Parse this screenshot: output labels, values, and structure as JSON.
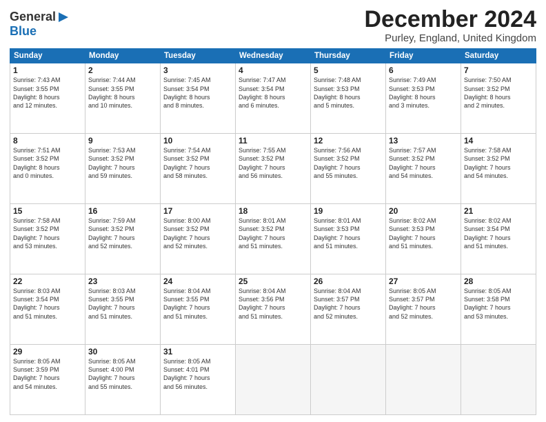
{
  "header": {
    "logo_line1": "General",
    "logo_line2": "Blue",
    "month": "December 2024",
    "location": "Purley, England, United Kingdom"
  },
  "weekdays": [
    "Sunday",
    "Monday",
    "Tuesday",
    "Wednesday",
    "Thursday",
    "Friday",
    "Saturday"
  ],
  "weeks": [
    [
      {
        "day": "1",
        "lines": [
          "Sunrise: 7:43 AM",
          "Sunset: 3:55 PM",
          "Daylight: 8 hours",
          "and 12 minutes."
        ]
      },
      {
        "day": "2",
        "lines": [
          "Sunrise: 7:44 AM",
          "Sunset: 3:55 PM",
          "Daylight: 8 hours",
          "and 10 minutes."
        ]
      },
      {
        "day": "3",
        "lines": [
          "Sunrise: 7:45 AM",
          "Sunset: 3:54 PM",
          "Daylight: 8 hours",
          "and 8 minutes."
        ]
      },
      {
        "day": "4",
        "lines": [
          "Sunrise: 7:47 AM",
          "Sunset: 3:54 PM",
          "Daylight: 8 hours",
          "and 6 minutes."
        ]
      },
      {
        "day": "5",
        "lines": [
          "Sunrise: 7:48 AM",
          "Sunset: 3:53 PM",
          "Daylight: 8 hours",
          "and 5 minutes."
        ]
      },
      {
        "day": "6",
        "lines": [
          "Sunrise: 7:49 AM",
          "Sunset: 3:53 PM",
          "Daylight: 8 hours",
          "and 3 minutes."
        ]
      },
      {
        "day": "7",
        "lines": [
          "Sunrise: 7:50 AM",
          "Sunset: 3:52 PM",
          "Daylight: 8 hours",
          "and 2 minutes."
        ]
      }
    ],
    [
      {
        "day": "8",
        "lines": [
          "Sunrise: 7:51 AM",
          "Sunset: 3:52 PM",
          "Daylight: 8 hours",
          "and 0 minutes."
        ]
      },
      {
        "day": "9",
        "lines": [
          "Sunrise: 7:53 AM",
          "Sunset: 3:52 PM",
          "Daylight: 7 hours",
          "and 59 minutes."
        ]
      },
      {
        "day": "10",
        "lines": [
          "Sunrise: 7:54 AM",
          "Sunset: 3:52 PM",
          "Daylight: 7 hours",
          "and 58 minutes."
        ]
      },
      {
        "day": "11",
        "lines": [
          "Sunrise: 7:55 AM",
          "Sunset: 3:52 PM",
          "Daylight: 7 hours",
          "and 56 minutes."
        ]
      },
      {
        "day": "12",
        "lines": [
          "Sunrise: 7:56 AM",
          "Sunset: 3:52 PM",
          "Daylight: 7 hours",
          "and 55 minutes."
        ]
      },
      {
        "day": "13",
        "lines": [
          "Sunrise: 7:57 AM",
          "Sunset: 3:52 PM",
          "Daylight: 7 hours",
          "and 54 minutes."
        ]
      },
      {
        "day": "14",
        "lines": [
          "Sunrise: 7:58 AM",
          "Sunset: 3:52 PM",
          "Daylight: 7 hours",
          "and 54 minutes."
        ]
      }
    ],
    [
      {
        "day": "15",
        "lines": [
          "Sunrise: 7:58 AM",
          "Sunset: 3:52 PM",
          "Daylight: 7 hours",
          "and 53 minutes."
        ]
      },
      {
        "day": "16",
        "lines": [
          "Sunrise: 7:59 AM",
          "Sunset: 3:52 PM",
          "Daylight: 7 hours",
          "and 52 minutes."
        ]
      },
      {
        "day": "17",
        "lines": [
          "Sunrise: 8:00 AM",
          "Sunset: 3:52 PM",
          "Daylight: 7 hours",
          "and 52 minutes."
        ]
      },
      {
        "day": "18",
        "lines": [
          "Sunrise: 8:01 AM",
          "Sunset: 3:52 PM",
          "Daylight: 7 hours",
          "and 51 minutes."
        ]
      },
      {
        "day": "19",
        "lines": [
          "Sunrise: 8:01 AM",
          "Sunset: 3:53 PM",
          "Daylight: 7 hours",
          "and 51 minutes."
        ]
      },
      {
        "day": "20",
        "lines": [
          "Sunrise: 8:02 AM",
          "Sunset: 3:53 PM",
          "Daylight: 7 hours",
          "and 51 minutes."
        ]
      },
      {
        "day": "21",
        "lines": [
          "Sunrise: 8:02 AM",
          "Sunset: 3:54 PM",
          "Daylight: 7 hours",
          "and 51 minutes."
        ]
      }
    ],
    [
      {
        "day": "22",
        "lines": [
          "Sunrise: 8:03 AM",
          "Sunset: 3:54 PM",
          "Daylight: 7 hours",
          "and 51 minutes."
        ]
      },
      {
        "day": "23",
        "lines": [
          "Sunrise: 8:03 AM",
          "Sunset: 3:55 PM",
          "Daylight: 7 hours",
          "and 51 minutes."
        ]
      },
      {
        "day": "24",
        "lines": [
          "Sunrise: 8:04 AM",
          "Sunset: 3:55 PM",
          "Daylight: 7 hours",
          "and 51 minutes."
        ]
      },
      {
        "day": "25",
        "lines": [
          "Sunrise: 8:04 AM",
          "Sunset: 3:56 PM",
          "Daylight: 7 hours",
          "and 51 minutes."
        ]
      },
      {
        "day": "26",
        "lines": [
          "Sunrise: 8:04 AM",
          "Sunset: 3:57 PM",
          "Daylight: 7 hours",
          "and 52 minutes."
        ]
      },
      {
        "day": "27",
        "lines": [
          "Sunrise: 8:05 AM",
          "Sunset: 3:57 PM",
          "Daylight: 7 hours",
          "and 52 minutes."
        ]
      },
      {
        "day": "28",
        "lines": [
          "Sunrise: 8:05 AM",
          "Sunset: 3:58 PM",
          "Daylight: 7 hours",
          "and 53 minutes."
        ]
      }
    ],
    [
      {
        "day": "29",
        "lines": [
          "Sunrise: 8:05 AM",
          "Sunset: 3:59 PM",
          "Daylight: 7 hours",
          "and 54 minutes."
        ]
      },
      {
        "day": "30",
        "lines": [
          "Sunrise: 8:05 AM",
          "Sunset: 4:00 PM",
          "Daylight: 7 hours",
          "and 55 minutes."
        ]
      },
      {
        "day": "31",
        "lines": [
          "Sunrise: 8:05 AM",
          "Sunset: 4:01 PM",
          "Daylight: 7 hours",
          "and 56 minutes."
        ]
      },
      {
        "day": "",
        "lines": []
      },
      {
        "day": "",
        "lines": []
      },
      {
        "day": "",
        "lines": []
      },
      {
        "day": "",
        "lines": []
      }
    ]
  ]
}
